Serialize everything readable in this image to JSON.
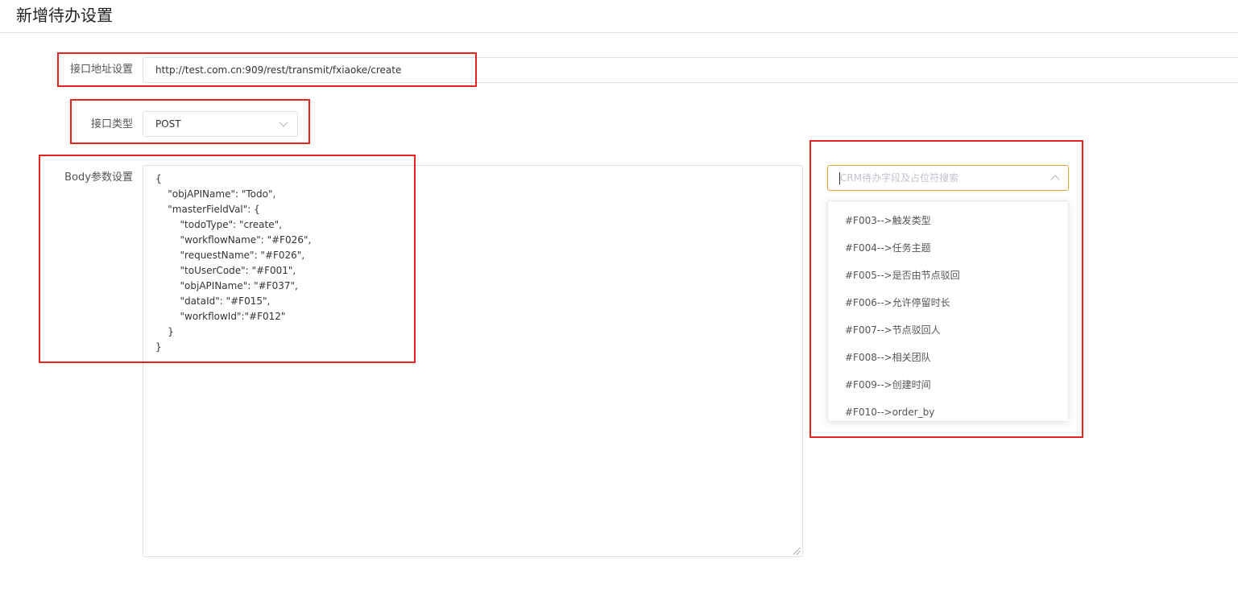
{
  "page": {
    "title": "新增待办设置"
  },
  "form": {
    "url": {
      "label": "接口地址设置",
      "value": "http://test.com.cn:909/rest/transmit/fxiaoke/create"
    },
    "method": {
      "label": "接口类型",
      "value": "POST"
    },
    "body": {
      "label": "Body参数设置",
      "lines": [
        "{",
        "    \"objAPIName\": \"Todo\",",
        "    \"masterFieldVal\": {",
        "        \"todoType\": \"create\",",
        "        \"workflowName\": \"#F026\",",
        "        \"requestName\": \"#F026\",",
        "        \"toUserCode\": \"#F001\",",
        "        \"objAPIName\": \"#F037\",",
        "        \"dataId\": \"#F015\",",
        "        \"workflowId\":\"#F012\"",
        "    }",
        "}"
      ]
    }
  },
  "field_search": {
    "placeholder": "CRM待办字段及占位符搜索",
    "options": [
      "#F003-->触发类型",
      "#F004-->任务主题",
      "#F005-->是否由节点驳回",
      "#F006-->允许停留时长",
      "#F007-->节点驳回人",
      "#F008-->相关团队",
      "#F009-->创建时间",
      "#F010-->order_by"
    ]
  },
  "colors": {
    "highlight_border": "#e8231f",
    "focus_border": "#e6a23c",
    "input_border": "#dcdfe6"
  }
}
